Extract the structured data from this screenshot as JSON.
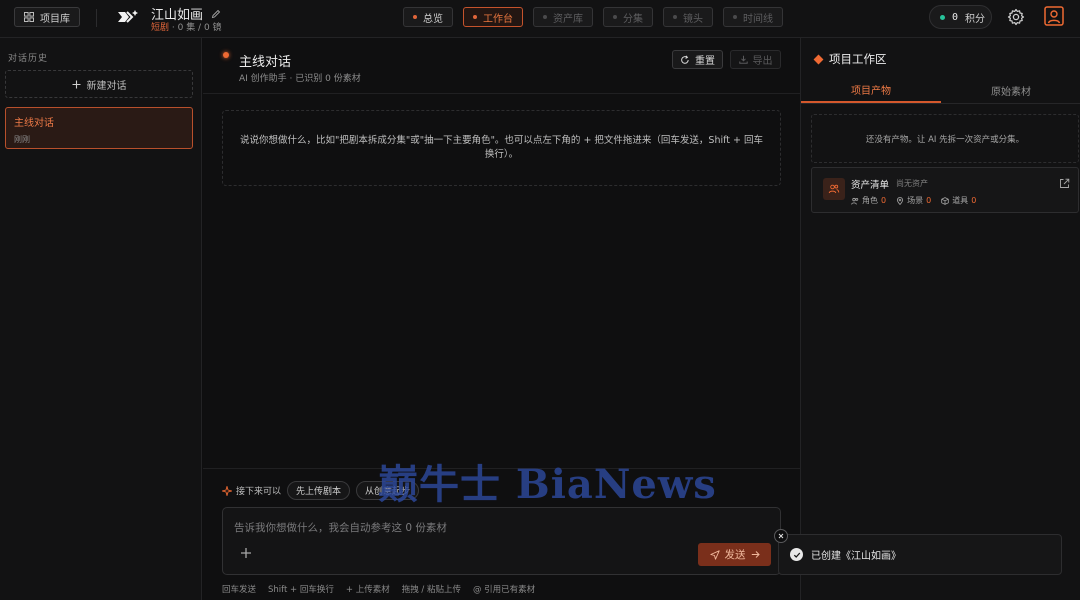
{
  "topbar": {
    "projects_button": "项目库",
    "project_title": "江山如画",
    "project_tag": "短剧",
    "project_stats": "· 0 集 / 0 镜",
    "nav": [
      {
        "label": "总览",
        "state": "normal"
      },
      {
        "label": "工作台",
        "state": "active"
      },
      {
        "label": "资产库",
        "state": "disabled"
      },
      {
        "label": "分集",
        "state": "disabled"
      },
      {
        "label": "镜头",
        "state": "disabled"
      },
      {
        "label": "时间线",
        "state": "disabled"
      }
    ],
    "credits_value": "0",
    "credits_label": "积分"
  },
  "sidebar": {
    "section_label": "对话历史",
    "new_chat": "新建对话",
    "chats": [
      {
        "title": "主线对话",
        "time": "刚刚"
      }
    ]
  },
  "main": {
    "title": "主线对话",
    "subtitle": "AI 创作助手 · 已识别 0 份素材",
    "reset_button": "重置",
    "export_button": "导出",
    "hint": "说说你想做什么，比如\"把剧本拆成分集\"或\"抽一下主要角色\"。也可以点左下角的 + 把文件拖进来（回车发送，Shift + 回车换行）。",
    "next_label": "接下来可以",
    "suggestions": [
      "先上传剧本",
      "从创意起步"
    ],
    "input_placeholder": "告诉我你想做什么，我会自动参考这 0 份素材",
    "send_button": "发送",
    "shortcuts": [
      "回车发送",
      "Shift + 回车换行",
      "+ 上传素材",
      "拖拽 / 粘贴上传",
      "@ 引用已有素材"
    ]
  },
  "workspace": {
    "title": "项目工作区",
    "tabs": [
      {
        "label": "项目产物",
        "active": true
      },
      {
        "label": "原始素材",
        "active": false
      }
    ],
    "empty_text": "还没有产物。让 AI 先拆一次资产或分集。",
    "asset_card": {
      "name": "资产清单",
      "note": "尚无资产",
      "counts": [
        {
          "label": "角色",
          "value": "0"
        },
        {
          "label": "场景",
          "value": "0"
        },
        {
          "label": "道具",
          "value": "0"
        }
      ]
    }
  },
  "toast": {
    "message": "已创建《江山如画》"
  },
  "watermark": "巅牛士 BiaNews",
  "colors": {
    "accent": "#ef6a33",
    "background": "#0e0e0f",
    "credits_dot": "#27c39a"
  }
}
